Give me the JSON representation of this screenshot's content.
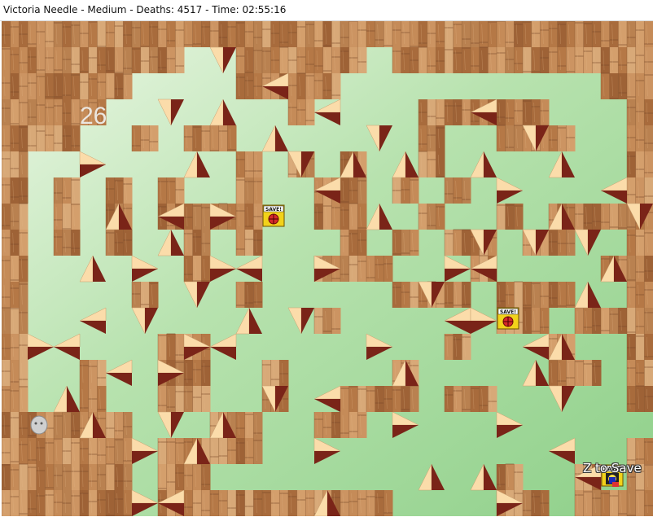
{
  "window": {
    "title": "Victoria Needle - Medium - Deaths: 4517 - Time: 02:55:16"
  },
  "game": {
    "room_number": "26",
    "save_hint": "Z to Save",
    "save_label": "SAVE!",
    "colors": {
      "background_light": "#dff2d6",
      "background_green": "#9fd89a",
      "wood_light": "#c9925f",
      "wood_dark": "#8a5030",
      "spike_face": "#fbdcaa",
      "spike_shade": "#7a2418",
      "save_box": "#f2d21a",
      "save_button": "#d62a2a"
    },
    "icons": [
      "spike-icon",
      "save-point-icon",
      "player-kid-icon",
      "ghost-warp-icon"
    ]
  }
}
